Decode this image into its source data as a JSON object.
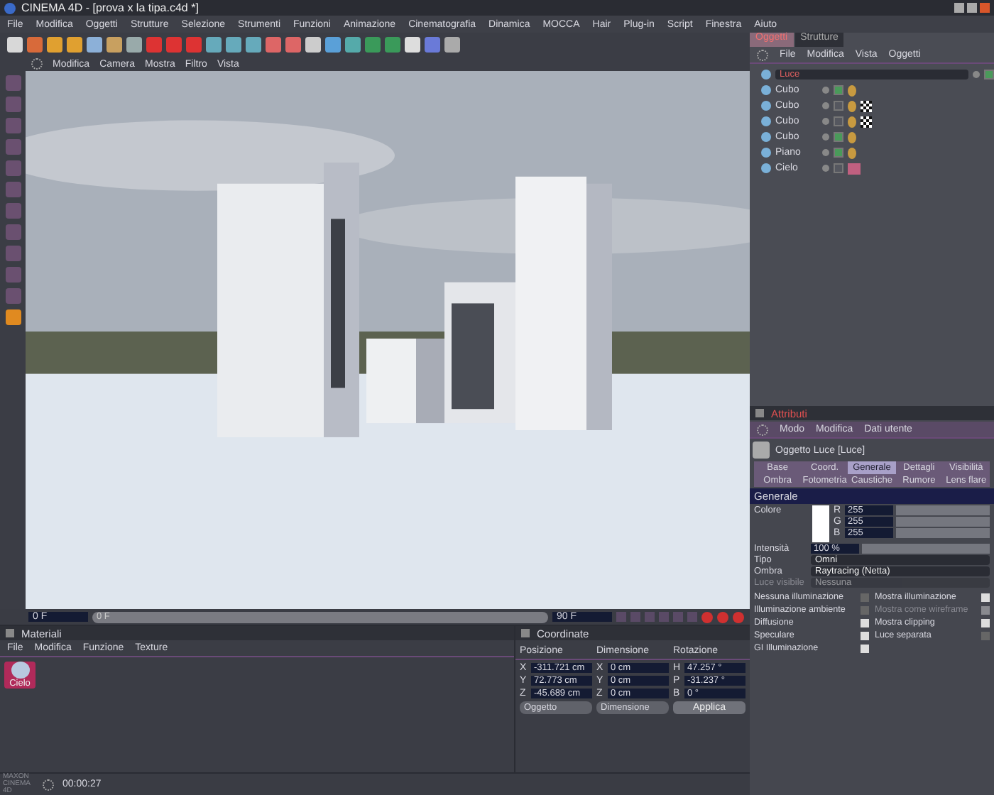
{
  "window": {
    "title": "CINEMA 4D - [prova x la tipa.c4d *]"
  },
  "menu": [
    "File",
    "Modifica",
    "Oggetti",
    "Strutture",
    "Selezione",
    "Strumenti",
    "Funzioni",
    "Animazione",
    "Cinematografia",
    "Dinamica",
    "MOCCA",
    "Hair",
    "Plug-in",
    "Script",
    "Finestra",
    "Aiuto"
  ],
  "viewport": {
    "menu": [
      "Modifica",
      "Camera",
      "Mostra",
      "Filtro",
      "Vista"
    ]
  },
  "object_manager": {
    "tabs": [
      {
        "label": "Oggetti",
        "selected": true
      },
      {
        "label": "Strutture",
        "selected": false
      }
    ],
    "menu": [
      "File",
      "Modifica",
      "Vista",
      "Oggetti"
    ],
    "objects": [
      {
        "name": "Luce",
        "selected": true,
        "enabled": true,
        "kind": "none"
      },
      {
        "name": "Cubo",
        "selected": false,
        "enabled": true,
        "kind": "phong"
      },
      {
        "name": "Cubo",
        "selected": false,
        "enabled": false,
        "kind": "texture"
      },
      {
        "name": "Cubo",
        "selected": false,
        "enabled": false,
        "kind": "texture"
      },
      {
        "name": "Cubo",
        "selected": false,
        "enabled": true,
        "kind": "phong"
      },
      {
        "name": "Piano",
        "selected": false,
        "enabled": true,
        "kind": "phong"
      },
      {
        "name": "Cielo",
        "selected": false,
        "enabled": false,
        "kind": "material"
      }
    ]
  },
  "attributes": {
    "title": "Attributi",
    "menu": [
      "Modo",
      "Modifica",
      "Dati utente"
    ],
    "object_label": "Oggetto Luce [Luce]",
    "tabs": [
      {
        "label": "Base",
        "selected": false
      },
      {
        "label": "Coord.",
        "selected": false
      },
      {
        "label": "Generale",
        "selected": true
      },
      {
        "label": "Dettagli",
        "selected": false
      },
      {
        "label": "Visibilità",
        "selected": false
      },
      {
        "label": "Ombra",
        "selected": false
      },
      {
        "label": "Fotometria",
        "selected": false
      },
      {
        "label": "Caustiche",
        "selected": false
      },
      {
        "label": "Rumore",
        "selected": false
      },
      {
        "label": "Lens flare",
        "selected": false
      }
    ],
    "section": "Generale",
    "color_label": "Colore",
    "channels": [
      {
        "name": "R",
        "value": "255",
        "level": 1
      },
      {
        "name": "G",
        "value": "255",
        "level": 1
      },
      {
        "name": "B",
        "value": "255",
        "level": 1
      }
    ],
    "intensity": {
      "label": "Intensità",
      "value": "100 %",
      "level": 1
    },
    "selects": [
      {
        "label": "Tipo",
        "value": "Omni",
        "disabled": false
      },
      {
        "label": "Ombra",
        "value": "Raytracing (Netta)",
        "disabled": false
      },
      {
        "label": "Luce visibile",
        "value": "Nessuna",
        "disabled": true
      }
    ],
    "checks": [
      {
        "label": "Nessuna illuminazione",
        "checked": false,
        "disabled": false
      },
      {
        "label": "Mostra illuminazione",
        "checked": true,
        "disabled": false
      },
      {
        "label": "Illuminazione ambiente",
        "checked": false,
        "disabled": false
      },
      {
        "label": "Mostra come wireframe",
        "checked": true,
        "disabled": true
      },
      {
        "label": "Diffusione",
        "checked": true,
        "disabled": false
      },
      {
        "label": "Mostra clipping",
        "checked": true,
        "disabled": false
      },
      {
        "label": "Speculare",
        "checked": true,
        "disabled": false
      },
      {
        "label": "Luce separata",
        "checked": false,
        "disabled": false
      },
      {
        "label": "GI Illuminazione",
        "checked": true,
        "disabled": false
      }
    ]
  },
  "timeline": {
    "start": "0 F",
    "marker": "0 F",
    "end": "90 F",
    "level": 0
  },
  "materials": {
    "title": "Materiali",
    "menu": [
      "File",
      "Modifica",
      "Funzione",
      "Texture"
    ],
    "items": [
      {
        "name": "Cielo",
        "selected": true
      }
    ]
  },
  "coordinates": {
    "title": "Coordinate",
    "columns": [
      "Posizione",
      "Dimensione",
      "Rotazione"
    ],
    "rows": [
      {
        "axis": [
          "X",
          "X",
          "H"
        ],
        "values": [
          "-311.721 cm",
          "0 cm",
          "47.257 °"
        ]
      },
      {
        "axis": [
          "Y",
          "Y",
          "P"
        ],
        "values": [
          "72.773 cm",
          "0 cm",
          "-31.237 °"
        ]
      },
      {
        "axis": [
          "Z",
          "Z",
          "B"
        ],
        "values": [
          "-45.689 cm",
          "0 cm",
          "0 °"
        ]
      }
    ],
    "mode": "Oggetto",
    "size_mode": "Dimensione",
    "apply": "Applica"
  },
  "brand": "MAXON CINEMA 4D",
  "status_bar": {
    "time": "00:00:27"
  }
}
